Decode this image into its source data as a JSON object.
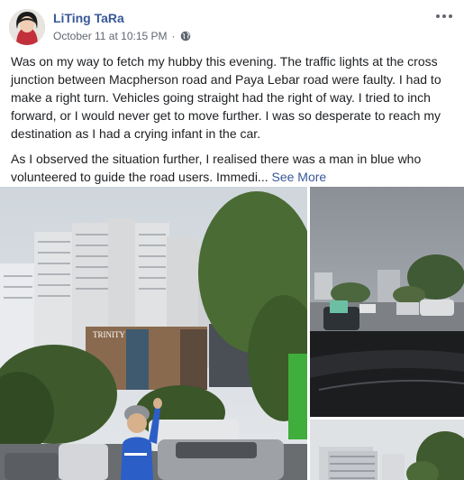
{
  "post": {
    "author": "LiTing TaRa",
    "timestamp": "October 11 at 10:15 PM",
    "separator": "·",
    "privacy_icon": "globe-icon",
    "menu_icon": "more-options-icon",
    "paragraphs": [
      "Was on my way to fetch my hubby this evening. The traffic lights at the cross junction between Macpherson road and Paya Lebar road were faulty. I had to make a right turn. Vehicles going straight had the right of way. I tried to inch forward, or I would never get to move further. I was so desperate to reach my destination as I had a crying infant in the car.",
      "As I observed the situation further, I realised there was a man in blue who volunteered to guide the road users. Immedi..."
    ],
    "see_more": "See More"
  },
  "photos": {
    "main_sign": "TRINITY"
  },
  "colors": {
    "link": "#385898",
    "text": "#1c1e21",
    "meta": "#606770",
    "volunteer_blue": "#2b5fc7"
  }
}
